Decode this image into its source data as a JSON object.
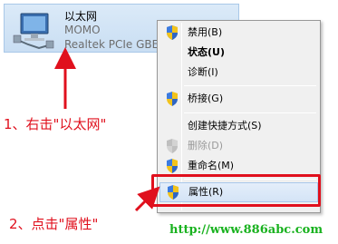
{
  "adapter": {
    "name": "以太网",
    "network": "MOMO",
    "device": "Realtek PCIe GBE F",
    "icon": "ethernet-adapter-icon"
  },
  "context_menu": {
    "items": [
      {
        "label": "禁用(B)",
        "shield": true,
        "bold": false,
        "disabled": false
      },
      {
        "label": "状态(U)",
        "shield": false,
        "bold": true,
        "disabled": false
      },
      {
        "label": "诊断(I)",
        "shield": false,
        "bold": false,
        "disabled": false
      },
      {
        "label": "桥接(G)",
        "shield": true,
        "bold": false,
        "disabled": false
      },
      {
        "label": "创建快捷方式(S)",
        "shield": false,
        "bold": false,
        "disabled": false
      },
      {
        "label": "删除(D)",
        "shield": true,
        "bold": false,
        "disabled": true
      },
      {
        "label": "重命名(M)",
        "shield": true,
        "bold": false,
        "disabled": false
      },
      {
        "label": "属性(R)",
        "shield": true,
        "bold": false,
        "disabled": false,
        "highlighted": true
      }
    ]
  },
  "annotations": {
    "step1": "1、右击\"以太网\"",
    "step2": "2、点击\"属性\"",
    "color": "#e0101d"
  },
  "watermark": "http://www.886abc.com",
  "colors": {
    "annotation_red": "#e0101d",
    "watermark_green": "#19b21f",
    "selection_blue": "#d4e4f6"
  }
}
